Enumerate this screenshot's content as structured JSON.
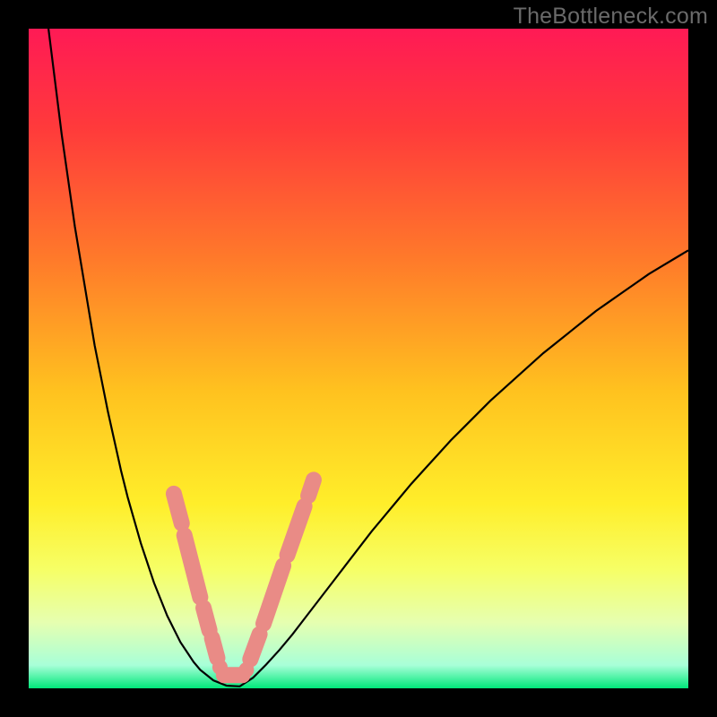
{
  "watermark": "TheBottleneck.com",
  "colors": {
    "frame": "#000000",
    "gradient_stops": [
      {
        "offset": 0.0,
        "color": "#ff1a55"
      },
      {
        "offset": 0.15,
        "color": "#ff3a3b"
      },
      {
        "offset": 0.35,
        "color": "#ff7a2a"
      },
      {
        "offset": 0.55,
        "color": "#ffc21f"
      },
      {
        "offset": 0.72,
        "color": "#ffee2a"
      },
      {
        "offset": 0.82,
        "color": "#f6ff66"
      },
      {
        "offset": 0.9,
        "color": "#e6ffb0"
      },
      {
        "offset": 0.965,
        "color": "#a8ffd8"
      },
      {
        "offset": 1.0,
        "color": "#00e87a"
      }
    ],
    "curve": "#000000",
    "marker_fill": "#e98b86",
    "marker_stroke": "#e98b86"
  },
  "chart_data": {
    "type": "line",
    "title": "",
    "xlabel": "",
    "ylabel": "",
    "xlim": [
      0,
      100
    ],
    "ylim": [
      0,
      100
    ],
    "x": [
      3,
      4,
      5,
      6,
      7,
      8,
      9,
      10,
      11,
      12,
      13,
      14,
      15,
      16,
      17,
      18,
      19,
      20,
      21,
      22,
      23,
      24,
      25,
      26,
      28,
      30,
      32,
      34,
      36,
      38,
      40,
      42,
      44,
      46,
      48,
      50,
      52,
      54,
      56,
      58,
      60,
      62,
      64,
      66,
      68,
      70,
      72,
      74,
      76,
      78,
      80,
      82,
      84,
      86,
      88,
      90,
      92,
      94,
      96,
      98,
      100
    ],
    "values": [
      100,
      92,
      84,
      77,
      70,
      64,
      58,
      52,
      47,
      42,
      37.5,
      33,
      29,
      25.5,
      22,
      19,
      16,
      13.5,
      11,
      9,
      7,
      5.5,
      4,
      2.8,
      1.2,
      0.4,
      0.3,
      1.6,
      3.6,
      5.8,
      8.2,
      10.8,
      13.4,
      16.0,
      18.6,
      21.2,
      23.8,
      26.2,
      28.6,
      31.0,
      33.2,
      35.4,
      37.6,
      39.6,
      41.6,
      43.6,
      45.4,
      47.2,
      49.0,
      50.8,
      52.4,
      54.0,
      55.6,
      57.2,
      58.6,
      60.0,
      61.4,
      62.8,
      64.0,
      65.2,
      66.4
    ],
    "markers": {
      "pill_segments": [
        {
          "x1": 22.0,
          "y1": 29.5,
          "x2": 23.2,
          "y2": 25.0
        },
        {
          "x1": 23.6,
          "y1": 23.2,
          "x2": 26.0,
          "y2": 13.8
        },
        {
          "x1": 26.5,
          "y1": 12.2,
          "x2": 27.4,
          "y2": 8.8
        },
        {
          "x1": 27.8,
          "y1": 7.6,
          "x2": 28.6,
          "y2": 4.6
        },
        {
          "x1": 33.6,
          "y1": 4.4,
          "x2": 35.0,
          "y2": 8.2
        },
        {
          "x1": 35.6,
          "y1": 9.8,
          "x2": 38.6,
          "y2": 18.6
        },
        {
          "x1": 39.2,
          "y1": 20.2,
          "x2": 41.8,
          "y2": 27.6
        },
        {
          "x1": 42.4,
          "y1": 29.2,
          "x2": 43.2,
          "y2": 31.6
        }
      ],
      "dots": [
        {
          "x": 29.0,
          "y": 3.2
        },
        {
          "x": 33.0,
          "y": 2.8
        }
      ],
      "flat_segment": {
        "x1": 29.6,
        "y1": 2.0,
        "x2": 32.4,
        "y2": 2.0
      }
    }
  }
}
